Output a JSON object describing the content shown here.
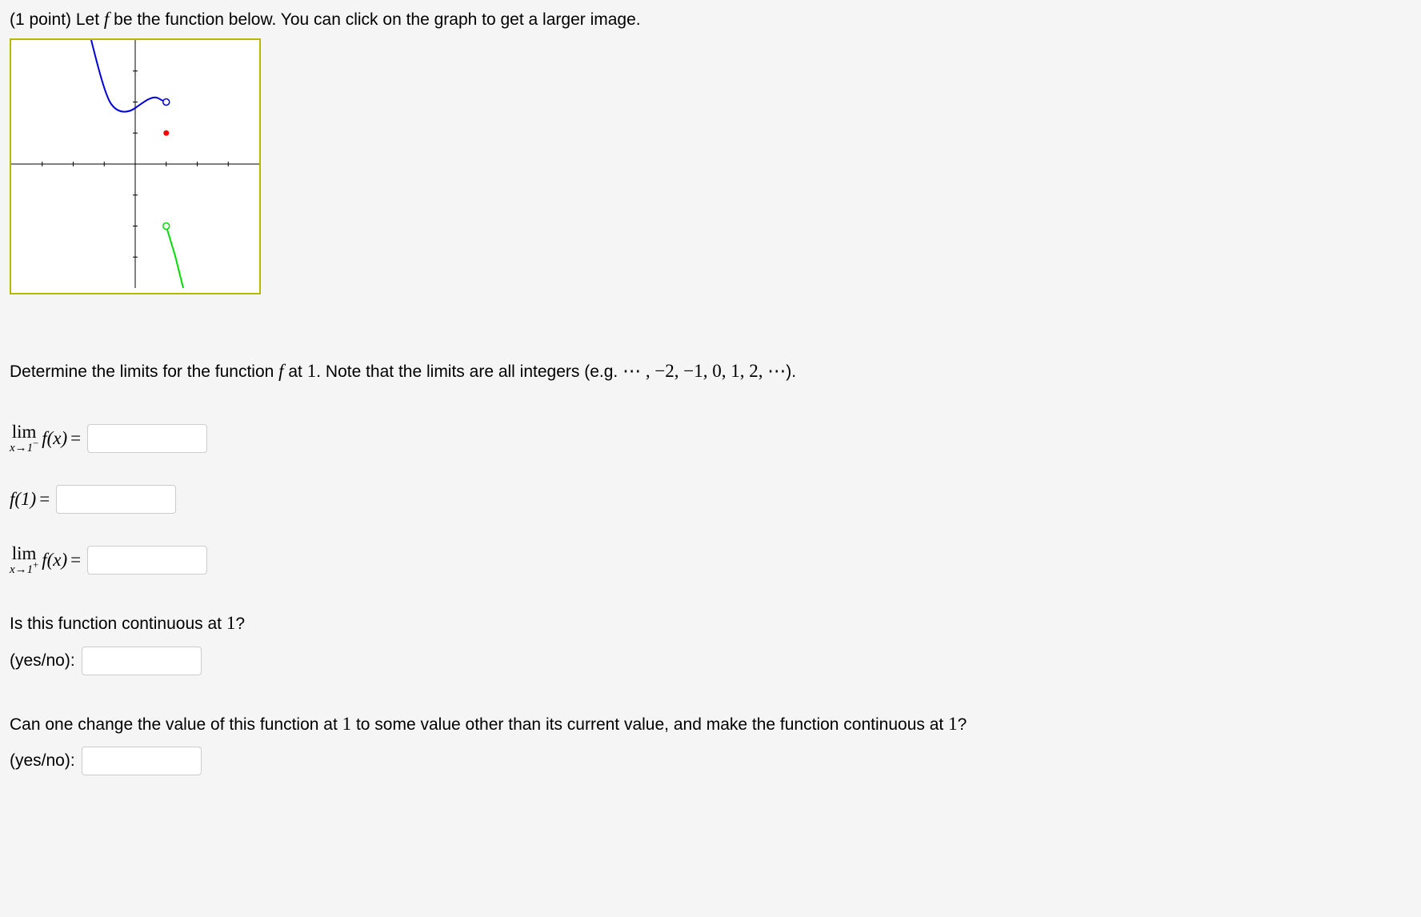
{
  "intro": {
    "prefix": "(1 point) Let",
    "f_symbol": "f",
    "suffix": " be the function below. You can click on the graph to get a larger image."
  },
  "instruction": {
    "prefix": "Determine the limits for the function",
    "f_symbol": "f",
    "mid": " at ",
    "point": "1",
    "post": ". Note that the limits are all integers (e.g. ",
    "integers": "⋯ , −2, −1, 0, 1, 2, ⋯",
    "close": ")."
  },
  "q1": {
    "lim_text": "lim",
    "approach": "x→1",
    "sup": "−",
    "fx": "f(x)",
    "equals": "="
  },
  "q2": {
    "fx": "f(1)",
    "equals": "="
  },
  "q3": {
    "lim_text": "lim",
    "approach": "x→1",
    "sup": "+",
    "fx": "f(x)",
    "equals": "="
  },
  "q4": {
    "question_pre": "Is this function continuous at ",
    "point": "1",
    "question_post": "?",
    "label": "(yes/no):"
  },
  "q5": {
    "question_pre": "Can one change the value of this function at ",
    "point1": "1",
    "question_mid": " to some value other than its current value, and make the function continuous at ",
    "point2": "1",
    "question_post": "?",
    "label": "(yes/no):"
  },
  "chart_data": {
    "type": "line",
    "title": "",
    "xlabel": "",
    "ylabel": "",
    "xlim": [
      -4,
      4
    ],
    "ylim": [
      -4,
      4
    ],
    "axes": true,
    "grid": false,
    "series": [
      {
        "name": "left-branch",
        "color": "#0000dd",
        "x": [
          -2,
          -1.5,
          -1,
          -0.5,
          0,
          0.5,
          0.8,
          1
        ],
        "y": [
          4,
          3.2,
          2.5,
          2.0,
          1.8,
          1.9,
          2.1,
          2
        ],
        "endpoint_open_at": {
          "x": 1,
          "y": 2
        }
      },
      {
        "name": "right-branch",
        "color": "#00dd00",
        "x": [
          1,
          1.2,
          1.4,
          1.6
        ],
        "y": [
          -2,
          -2.8,
          -3.5,
          -4
        ],
        "endpoint_open_at": {
          "x": 1,
          "y": -2
        }
      }
    ],
    "points": [
      {
        "name": "f(1)",
        "x": 1,
        "y": 1,
        "color": "#ff0000",
        "filled": true
      }
    ],
    "implied": {
      "lim_left_at_1": 2,
      "f_at_1": 1,
      "lim_right_at_1": -2
    }
  }
}
